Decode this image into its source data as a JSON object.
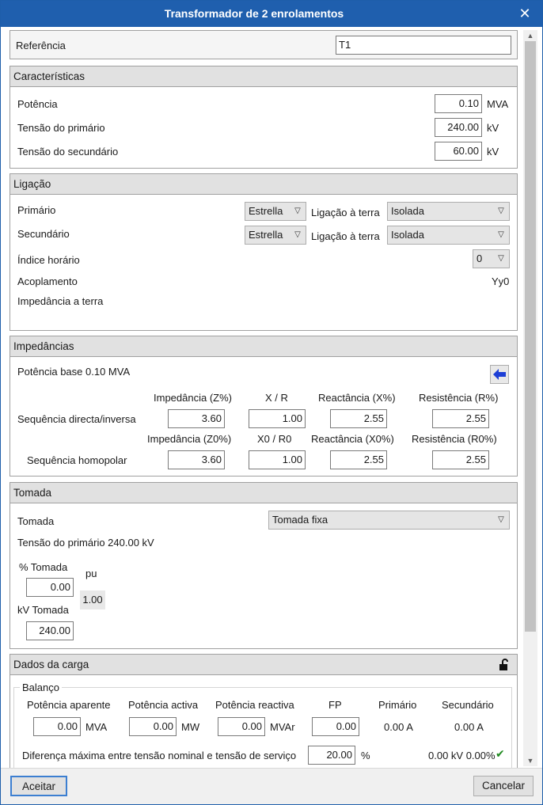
{
  "window": {
    "title": "Transformador de 2 enrolamentos",
    "close": "✕"
  },
  "reference": {
    "label": "Referência",
    "value": "T1"
  },
  "characteristics": {
    "header": "Características",
    "power": {
      "label": "Potência",
      "value": "0.10",
      "unit": "MVA"
    },
    "primary_voltage": {
      "label": "Tensão do primário",
      "value": "240.00",
      "unit": "kV"
    },
    "secondary_voltage": {
      "label": "Tensão do secundário",
      "value": "60.00",
      "unit": "kV"
    }
  },
  "connection": {
    "header": "Ligação",
    "primary": {
      "label": "Primário",
      "type": "Estrella",
      "ground_label": "Ligação à terra",
      "ground": "Isolada"
    },
    "secondary": {
      "label": "Secundário",
      "type": "Estrella",
      "ground_label": "Ligação à terra",
      "ground": "Isolada"
    },
    "hour_index": {
      "label": "Índice horário",
      "value": "0"
    },
    "coupling": {
      "label": "Acoplamento",
      "value": "Yy0"
    },
    "ground_impedance": {
      "label": "Impedância a terra"
    }
  },
  "impedances": {
    "header": "Impedâncias",
    "base_power": "Potência base 0.10 MVA",
    "positive": {
      "headers": [
        "Impedância (Z%)",
        "X / R",
        "Reactância (X%)",
        "Resistência (R%)"
      ],
      "label": "Sequência directa/inversa",
      "values": [
        "3.60",
        "1.00",
        "2.55",
        "2.55"
      ]
    },
    "zero": {
      "headers": [
        "Impedância (Z0%)",
        "X0 / R0",
        "Reactância (X0%)",
        "Resistência (R0%)"
      ],
      "label": "Sequência homopolar",
      "values": [
        "3.60",
        "1.00",
        "2.55",
        "2.55"
      ]
    }
  },
  "tap": {
    "header": "Tomada",
    "tap_label": "Tomada",
    "tap_value": "Tomada fixa",
    "primary_voltage": "Tensão do primário 240.00 kV",
    "percent_label": "% Tomada",
    "percent_value": "0.00",
    "pu_label": "pu",
    "pu_value": "1.00",
    "kv_label": "kV Tomada",
    "kv_value": "240.00"
  },
  "load": {
    "header": "Dados da carga",
    "balance_label": "Balanço",
    "columns": [
      "Potência aparente",
      "Potência activa",
      "Potência reactiva",
      "FP",
      "Primário",
      "Secundário"
    ],
    "apparent": {
      "value": "0.00",
      "unit": "MVA"
    },
    "active": {
      "value": "0.00",
      "unit": "MW"
    },
    "reactive": {
      "value": "0.00",
      "unit": "MVAr"
    },
    "fp": "0.00",
    "primary_current": "0.00 A",
    "secondary_current": "0.00 A",
    "max_diff_label": "Diferença máxima entre tensão nominal e tensão de serviço",
    "max_diff_value": "20.00",
    "max_diff_unit": "%",
    "status": "0.00 kV 0.00%"
  },
  "buttons": {
    "accept": "Aceitar",
    "cancel": "Cancelar"
  }
}
